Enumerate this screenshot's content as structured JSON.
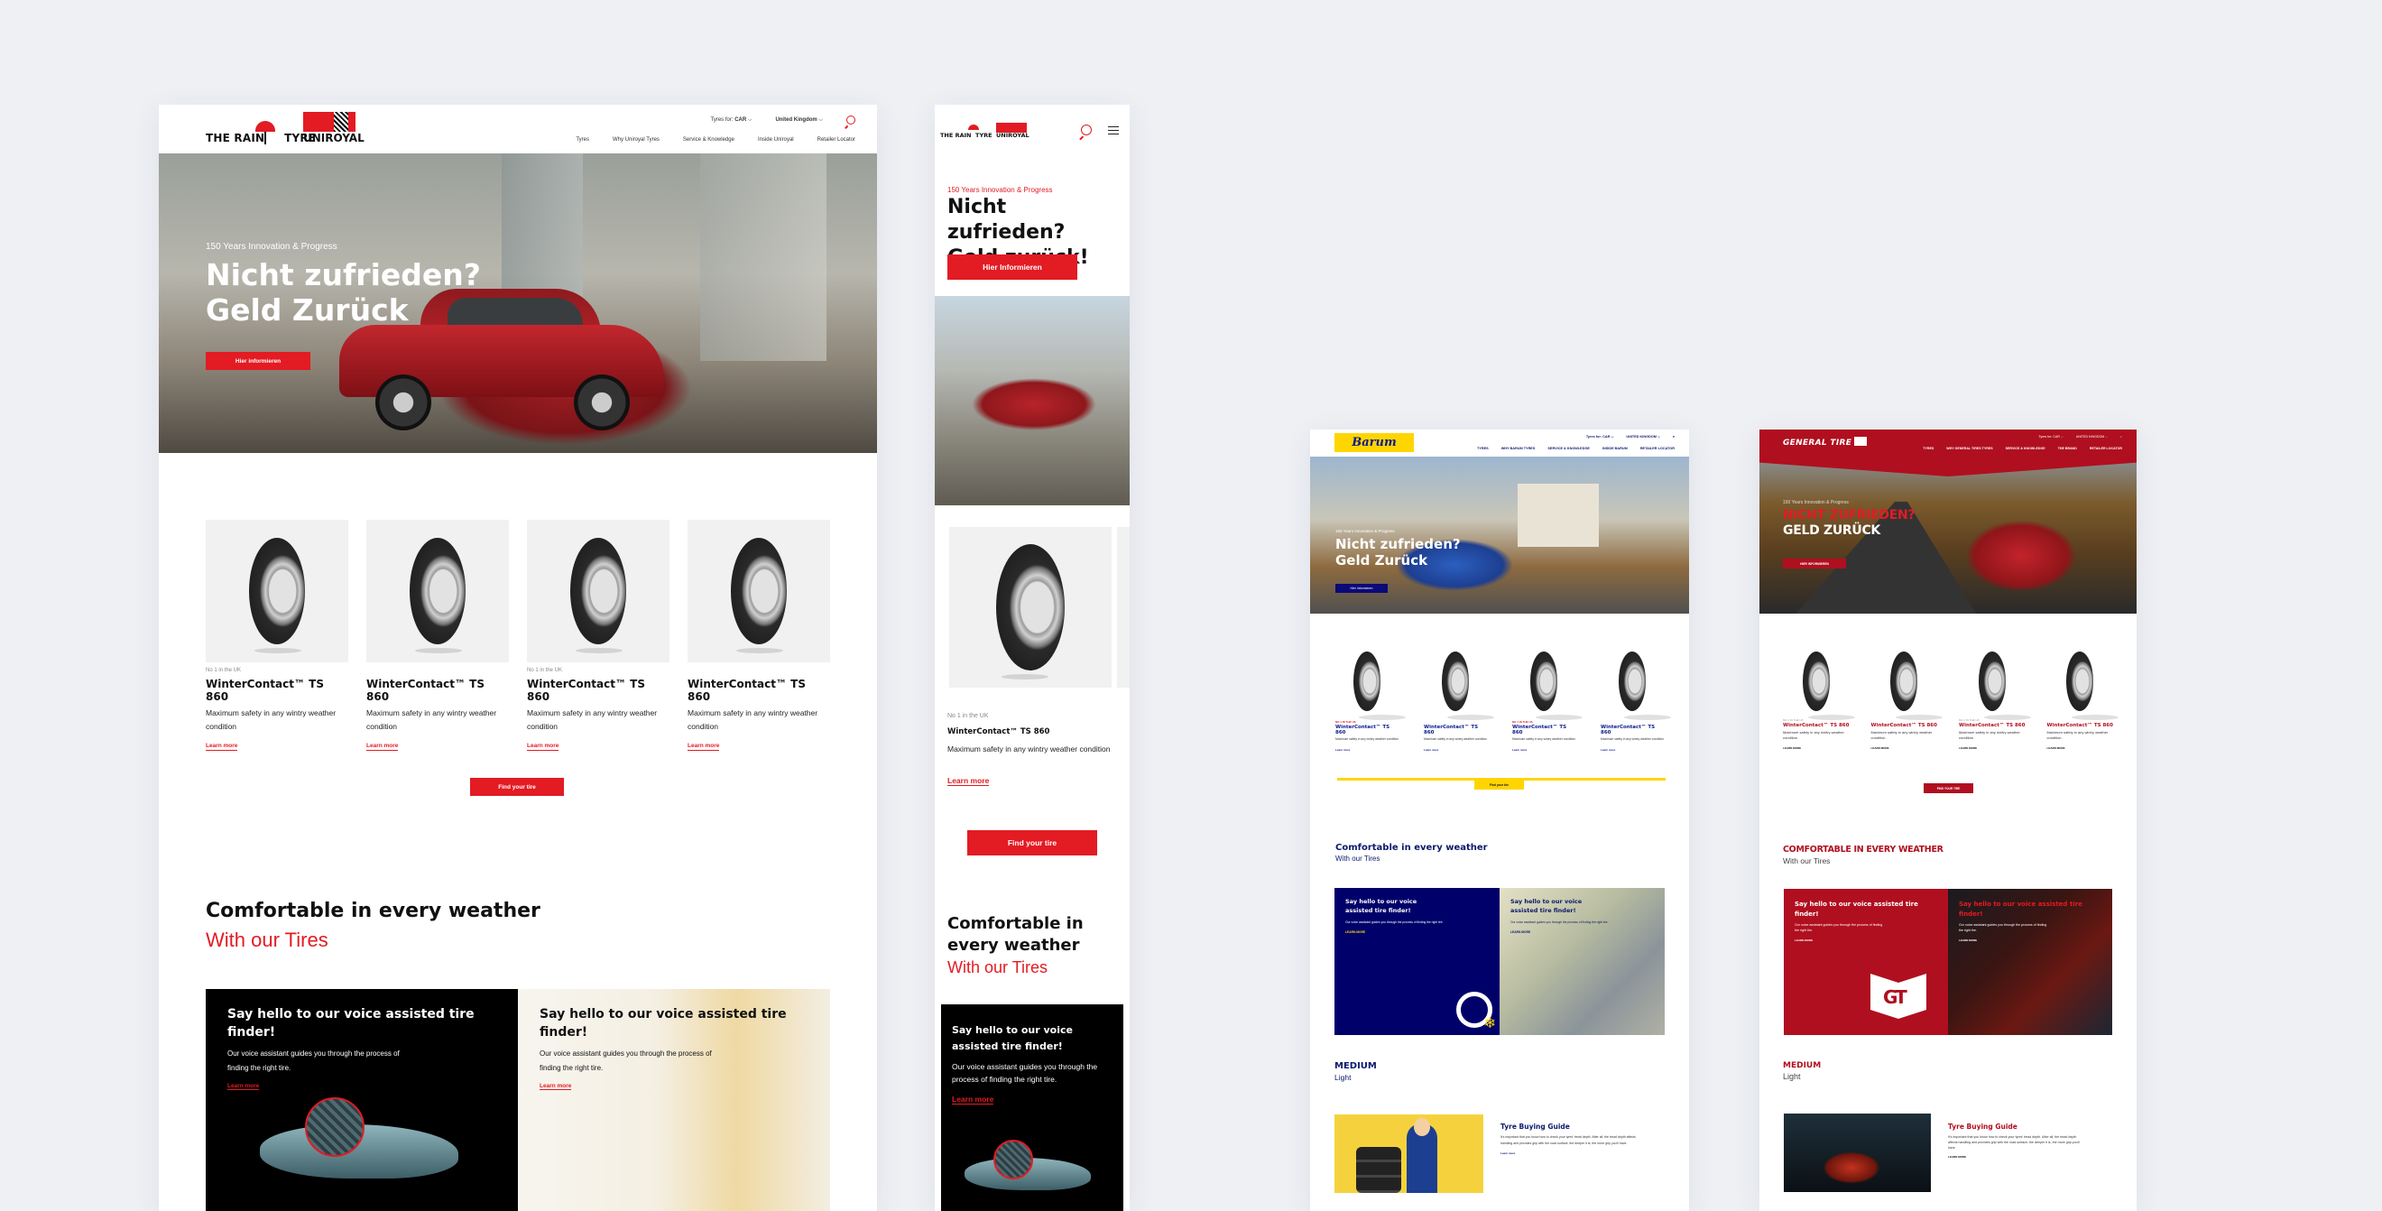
{
  "uniroyal_desktop": {
    "logo": {
      "left_text": "THE RAIN",
      "mid_text": "TYRE",
      "brand": "UNIROYAL"
    },
    "utility": {
      "tyres_for_label": "Tyres for:",
      "tyres_for_value": "CAR",
      "country": "United Kingdom"
    },
    "nav": [
      "Tyres",
      "Why Uniroyal Tyres",
      "Service & Knowledge",
      "Inside Uniroyal",
      "Retailer Locator"
    ],
    "hero": {
      "kicker": "150 Years Innovation & Progress",
      "title_line1": "Nicht zufrieden?",
      "title_line2": "Geld Zurück",
      "cta": "Hier informieren"
    },
    "products": [
      {
        "tag": "No 1 in the UK",
        "name": "WinterContact™ TS 860",
        "desc": "Maximum safety in any wintry weather condition",
        "link": "Learn more"
      },
      {
        "tag": "",
        "name": "WinterContact™ TS 860",
        "desc": "Maximum safety in any wintry weather condition",
        "link": "Learn more"
      },
      {
        "tag": "No 1 in the UK",
        "name": "WinterContact™ TS 860",
        "desc": "Maximum safety in any wintry weather condition",
        "link": "Learn more"
      },
      {
        "tag": "",
        "name": "WinterContact™ TS 860",
        "desc": "Maximum safety in any wintry weather condition",
        "link": "Learn more"
      }
    ],
    "find_cta": "Find your tire",
    "section": {
      "title": "Comfortable in every weather",
      "subtitle": "With our Tires"
    },
    "promos": [
      {
        "title": "Say hello to our voice assisted tire finder!",
        "body": "Our voice assistant guides you through the process of finding the right tire.",
        "link": "Learn more"
      },
      {
        "title": "Say hello to our voice assisted tire finder!",
        "body": "Our voice assistant guides you through the process of finding the right tire.",
        "link": "Learn more"
      }
    ]
  },
  "uniroyal_mobile": {
    "logo": {
      "left_text": "THE RAIN",
      "mid_text": "TYRE",
      "brand": "UNIROYAL"
    },
    "hero": {
      "kicker": "150 Years Innovation & Progress",
      "title_line1": "Nicht zufrieden?",
      "title_line2": "Geld zurück!",
      "cta": "Hier Informieren"
    },
    "product": {
      "tag": "No 1 in the UK",
      "name": "WinterContact™ TS 860",
      "desc": "Maximum safety in any wintry weather condition",
      "link": "Learn more"
    },
    "find_cta": "Find your tire",
    "section": {
      "title": "Comfortable in every weather",
      "subtitle": "With our Tires"
    },
    "promo": {
      "title": "Say hello to our voice assisted tire finder!",
      "body": "Our voice assistant guides you through the process of finding the right tire.",
      "link": "Learn more"
    }
  },
  "barum": {
    "logo": "Barum",
    "utility": {
      "tyres_for_label": "Tyres for:",
      "tyres_for_value": "CAR",
      "country": "UNITED KINGDOM"
    },
    "nav": [
      "TYRES",
      "WHY BARUM TYRES",
      "SERVICE & KNOWLEDGE",
      "INSIDE BARUM",
      "RETAILER LOCATOR"
    ],
    "hero": {
      "kicker": "150 Years Innovation & Progress",
      "title_line1": "Nicht zufrieden?",
      "title_line2": "Geld Zurück",
      "cta": "Hier informieren"
    },
    "products": [
      {
        "tag": "NO 1 IN THE UK",
        "name": "WinterContact™ TS 860",
        "desc": "Maximum safety in any wintry weather condition",
        "link": "Learn more"
      },
      {
        "tag": "",
        "name": "WinterContact™ TS 860",
        "desc": "Maximum safety in any wintry weather condition",
        "link": "Learn more"
      },
      {
        "tag": "NO 1 IN THE UK",
        "name": "WinterContact™ TS 860",
        "desc": "Maximum safety in any wintry weather condition",
        "link": "Learn more"
      },
      {
        "tag": "",
        "name": "WinterContact™ TS 860",
        "desc": "Maximum safety in any wintry weather condition",
        "link": "Learn more"
      }
    ],
    "find_cta": "Find your tire",
    "section": {
      "title": "Comfortable in every weather",
      "subtitle": "With our Tires"
    },
    "promos": [
      {
        "title": "Say hello to our voice assisted tire finder!",
        "body": "Our voice assistant guides you through the process of finding the right tire.",
        "link": "LEARN MORE"
      },
      {
        "title": "Say hello to our voice assisted tire finder!",
        "body": "Our voice assistant guides you through the process of finding the right tire.",
        "link": "LEARN MORE"
      }
    ],
    "section2": {
      "title": "MEDIUM",
      "subtitle": "Light"
    },
    "guide": {
      "title": "Tyre Buying Guide",
      "body": "It's important that you know how to check your tyres' tread depth. After all, the tread depth affects handling and provides grip with the road surface, the deeper it is, the more grip you'll have.",
      "link": "Learn more"
    }
  },
  "general": {
    "logo": "GENERAL TIRE",
    "utility": {
      "tyres_for_label": "Tyres for:",
      "tyres_for_value": "CAR",
      "country": "UNITED KINGDOM"
    },
    "nav": [
      "TYRES",
      "WHY GENERAL TIRES TYRES",
      "SERVICE & KNOWLEDGE",
      "THE BRAND",
      "RETAILER LOCATOR"
    ],
    "hero": {
      "kicker": "150 Years Innovation & Progress",
      "title_line1": "NICHT ZUFRIEDEN?",
      "title_line2": "GELD ZURÜCK",
      "cta": "HIER INFORMIEREN"
    },
    "products": [
      {
        "tag": "NO 1 IN THE UK",
        "name": "WinterContact™ TS 860",
        "desc": "Maximum safety in any wintry weather condition",
        "link": "LEARN MORE"
      },
      {
        "tag": "",
        "name": "WinterContact™ TS 860",
        "desc": "Maximum safety in any wintry weather condition",
        "link": "LEARN MORE"
      },
      {
        "tag": "NO 1 IN THE UK",
        "name": "WinterContact™ TS 860",
        "desc": "Maximum safety in any wintry weather condition",
        "link": "LEARN MORE"
      },
      {
        "tag": "",
        "name": "WinterContact™ TS 860",
        "desc": "Maximum safety in any wintry weather condition",
        "link": "LEARN MORE"
      }
    ],
    "find_cta": "FIND YOUR TIRE",
    "section": {
      "title": "COMFORTABLE IN EVERY WEATHER",
      "subtitle": "With our Tires"
    },
    "promos": [
      {
        "title": "Say hello to our voice assisted tire finder!",
        "body": "Our voice assistant guides you through the process of finding the right tire.",
        "link": "LEARN MORE"
      },
      {
        "title": "Say hello to our voice assisted tire finder!",
        "body": "Our voice assistant guides you through the process of finding the right tire.",
        "link": "LEARN MORE"
      }
    ],
    "section2": {
      "title": "MEDIUM",
      "subtitle": "Light"
    },
    "guide": {
      "title": "Tyre Buying Guide",
      "body": "It's important that you know how to check your tyres' tread depth. After all, the tread depth affects handling and provides grip with the road surface. the deeper it is, the more grip you'll have.",
      "link": "LEARN MORE"
    },
    "promo_logo": "GT"
  },
  "colors": {
    "uniroyal_red": "#e31b23",
    "barum_yellow": "#ffd500",
    "barum_navy": "#00006b",
    "general_red": "#b00f1f",
    "background": "#eef0f4"
  }
}
